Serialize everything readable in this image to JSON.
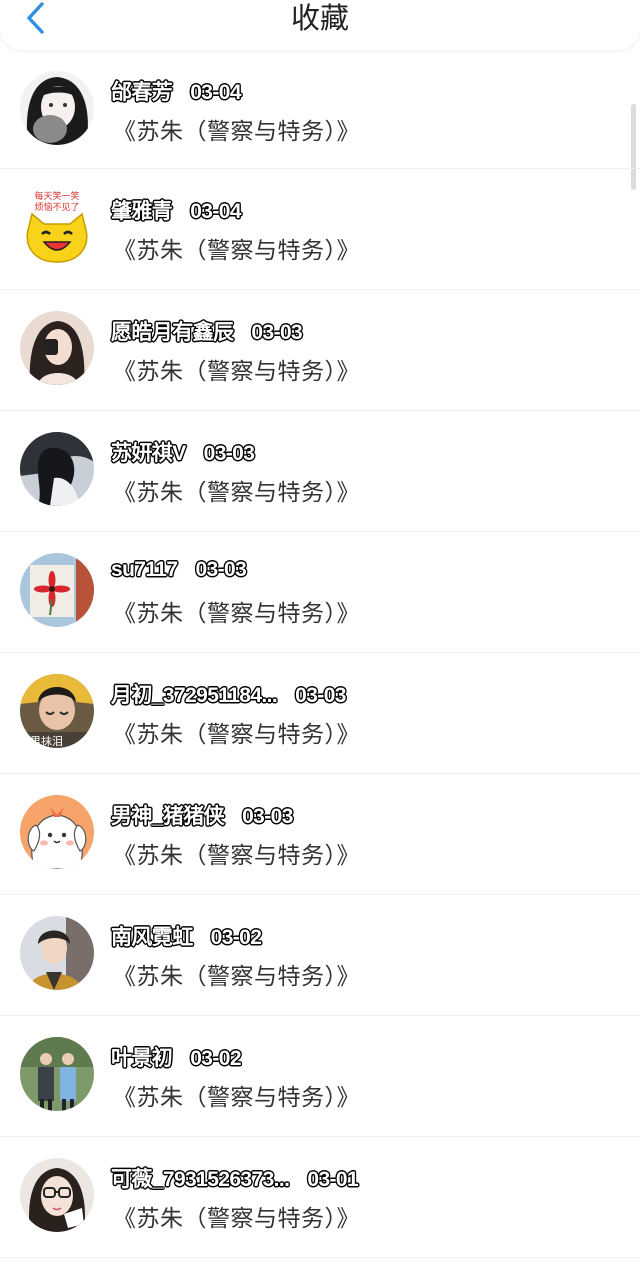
{
  "header": {
    "title": "收藏"
  },
  "items": [
    {
      "name": "邰春芳",
      "date": "03-04",
      "book": "《苏朱（警察与特务）》",
      "avatar_icon": "girl-sketch-avatar"
    },
    {
      "name": "肇雅青",
      "date": "03-04",
      "book": "《苏朱（警察与特务）》",
      "avatar_icon": "yellow-cat-sticker-avatar",
      "avatar_text": "每天笑一笑\n烦恼不见了"
    },
    {
      "name": "愿皓月有鑫辰",
      "date": "03-03",
      "book": "《苏朱（警察与特务）》",
      "avatar_icon": "girl-photo-avatar"
    },
    {
      "name": "苏妍祺V",
      "date": "03-03",
      "book": "《苏朱（警察与特务）》",
      "avatar_icon": "dark-hair-girl-avatar"
    },
    {
      "name": "su7117",
      "date": "03-03",
      "book": "《苏朱（警察与特务）》",
      "avatar_icon": "red-flower-painting-avatar"
    },
    {
      "name": "月初_372951184...",
      "date": "03-03",
      "book": "《苏朱（警察与特务）》",
      "avatar_icon": "crying-boy-avatar",
      "avatar_text": "男抹泪"
    },
    {
      "name": "男神_猪猪侠",
      "date": "03-03",
      "book": "《苏朱（警察与特务）》",
      "avatar_icon": "cartoon-puppy-avatar"
    },
    {
      "name": "南风霓虹",
      "date": "03-02",
      "book": "《苏朱（警察与特务）》",
      "avatar_icon": "boy-photo-avatar"
    },
    {
      "name": "叶景初",
      "date": "03-02",
      "book": "《苏朱（警察与特务）》",
      "avatar_icon": "two-people-photo-avatar"
    },
    {
      "name": "可薇_7931526373...",
      "date": "03-01",
      "book": "《苏朱（警察与特务）》",
      "avatar_icon": "girl-glasses-avatar"
    }
  ],
  "colors": {
    "accent": "#2f8fe0",
    "book_text": "#333333",
    "separator": "#efefef"
  }
}
